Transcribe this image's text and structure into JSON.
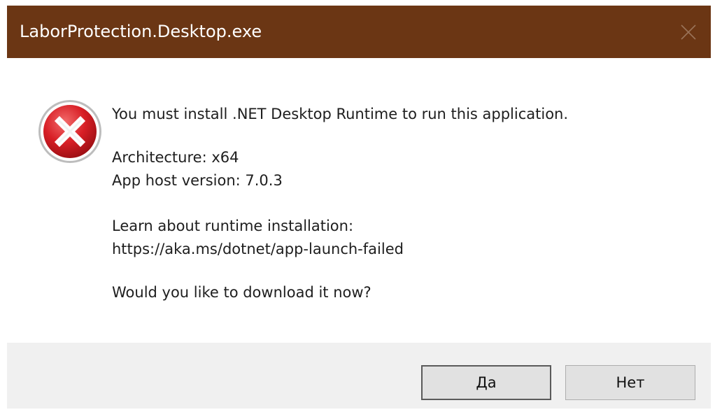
{
  "window": {
    "title": "LaborProtection.Desktop.exe"
  },
  "message": {
    "line1": "You must install .NET Desktop Runtime to run this application.",
    "architecture": "Architecture: x64",
    "app_host_version": "App host version: 7.0.3",
    "learn_about": "Learn about runtime installation:",
    "url": "https://aka.ms/dotnet/app-launch-failed",
    "question": "Would you like to download it now?"
  },
  "buttons": {
    "yes_label": "Да",
    "no_label": "Нет"
  },
  "icons": {
    "error": "error-icon",
    "close": "close-icon"
  },
  "colors": {
    "titlebar": "#6b3614",
    "footer": "#f0f0f0",
    "error_red": "#c8102e"
  }
}
